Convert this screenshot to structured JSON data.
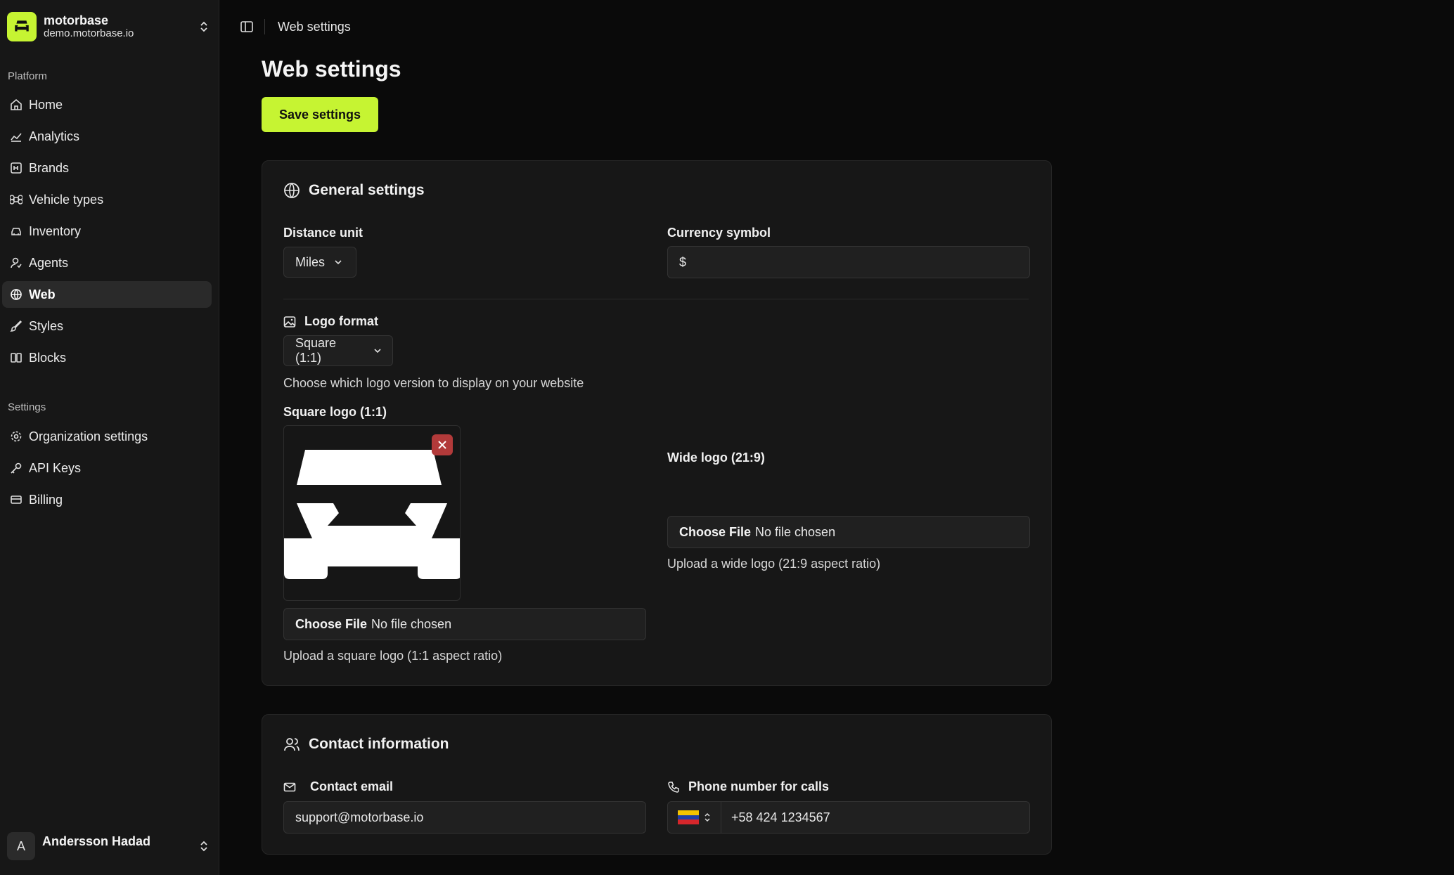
{
  "org": {
    "name": "motorbase",
    "domain": "demo.motorbase.io"
  },
  "sidebar": {
    "platform_label": "Platform",
    "platform_items": [
      {
        "label": "Home",
        "icon": "home-icon"
      },
      {
        "label": "Analytics",
        "icon": "chart-line-icon"
      },
      {
        "label": "Brands",
        "icon": "brand-icon"
      },
      {
        "label": "Vehicle types",
        "icon": "command-icon"
      },
      {
        "label": "Inventory",
        "icon": "car-icon"
      },
      {
        "label": "Agents",
        "icon": "user-icon"
      },
      {
        "label": "Web",
        "icon": "globe-icon",
        "active": true
      },
      {
        "label": "Styles",
        "icon": "brush-icon"
      },
      {
        "label": "Blocks",
        "icon": "blocks-icon"
      }
    ],
    "settings_label": "Settings",
    "settings_items": [
      {
        "label": "Organization settings",
        "icon": "gear-icon"
      },
      {
        "label": "API Keys",
        "icon": "key-icon"
      },
      {
        "label": "Billing",
        "icon": "credit-card-icon"
      }
    ]
  },
  "user": {
    "initial": "A",
    "name": "Andersson Hadad"
  },
  "header": {
    "breadcrumb": "Web settings"
  },
  "page": {
    "title": "Web settings",
    "save_label": "Save settings"
  },
  "general": {
    "title": "General settings",
    "distance_label": "Distance unit",
    "distance_value": "Miles",
    "currency_label": "Currency symbol",
    "currency_value": "$",
    "logo_format_label": "Logo format",
    "logo_format_value": "Square (1:1)",
    "logo_format_help": "Choose which logo version to display on your website",
    "square_logo_label": "Square logo (1:1)",
    "square_choose": "Choose File",
    "square_file_status": "No file chosen",
    "square_help": "Upload a square logo (1:1 aspect ratio)",
    "wide_logo_label": "Wide logo (21:9)",
    "wide_choose": "Choose File",
    "wide_file_status": "No file chosen",
    "wide_help": "Upload a wide logo (21:9 aspect ratio)"
  },
  "contact": {
    "title": "Contact information",
    "email_label": "Contact email",
    "email_value": "support@motorbase.io",
    "phone_label": "Phone number for calls",
    "phone_value": "+58 424 1234567"
  },
  "colors": {
    "accent": "#c6f432",
    "remove": "#b23a3a",
    "flag_yellow": "#f4c400",
    "flag_blue": "#1f3fa6",
    "flag_red": "#d6262b"
  }
}
